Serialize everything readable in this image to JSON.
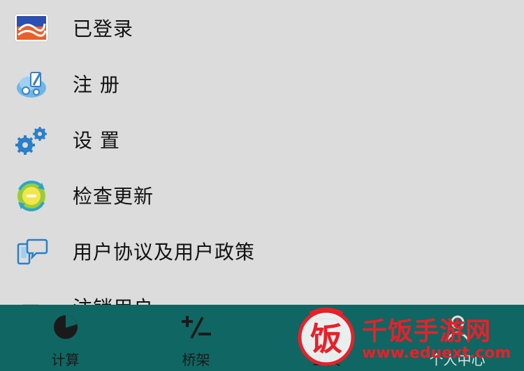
{
  "menu": {
    "items": [
      {
        "label": "已登录",
        "icon": "logo-icon"
      },
      {
        "label": "注 册",
        "icon": "register-icon"
      },
      {
        "label": "设 置",
        "icon": "settings-gears-icon"
      },
      {
        "label": "检查更新",
        "icon": "update-refresh-icon"
      },
      {
        "label": "用户协议及用户政策",
        "icon": "chat-phone-icon"
      },
      {
        "label": "注销用户",
        "icon": "document-icon"
      }
    ]
  },
  "tabbar": {
    "tabs": [
      {
        "label": "计算",
        "icon": "pie-chart-icon"
      },
      {
        "label": "桥架",
        "icon": "plus-minus-icon"
      },
      {
        "label": "工具",
        "icon": "tools-icon"
      },
      {
        "label": "个人中心",
        "icon": "person-icon"
      }
    ]
  },
  "watermark": {
    "title": "千饭手游网",
    "url": "www.eduext.com",
    "badge_char": "饭"
  },
  "colors": {
    "background": "#dcdcdc",
    "tabbar": "#106662",
    "watermark_red": "#e8202a"
  }
}
